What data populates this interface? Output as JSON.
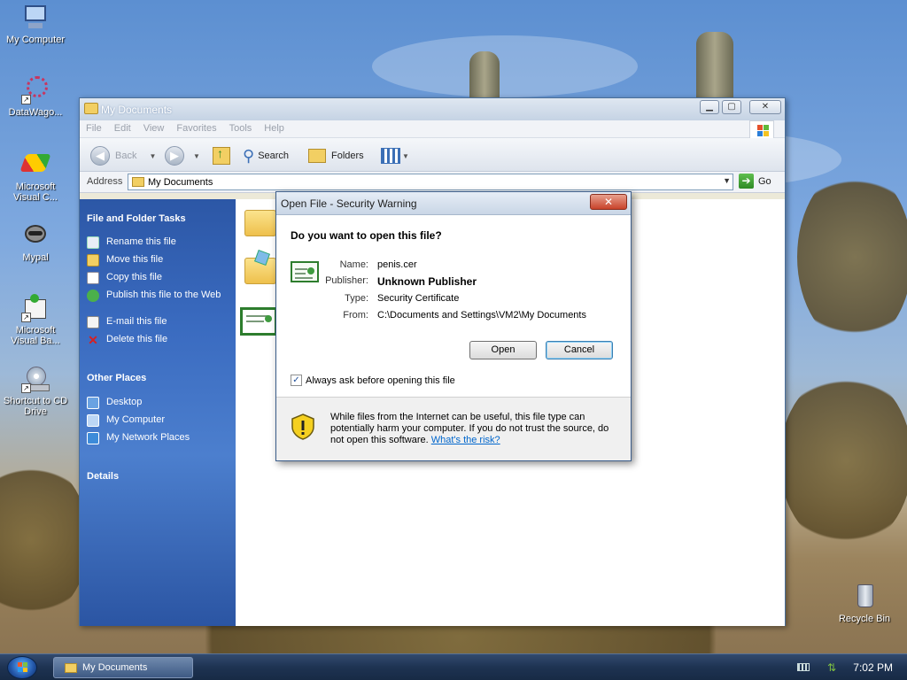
{
  "desktop": {
    "icons": [
      {
        "label": "My Computer"
      },
      {
        "label": "DataWago..."
      },
      {
        "label": "Microsoft Visual C..."
      },
      {
        "label": "Mypal"
      },
      {
        "label": "Microsoft Visual Ba..."
      },
      {
        "label": "Shortcut to CD Drive"
      },
      {
        "label": "Recycle Bin"
      }
    ]
  },
  "explorer": {
    "title": "My Documents",
    "menu": [
      "File",
      "Edit",
      "View",
      "Favorites",
      "Tools",
      "Help"
    ],
    "toolbar": {
      "back": "Back",
      "search": "Search",
      "folders": "Folders"
    },
    "address": {
      "label": "Address",
      "value": "My Documents",
      "go": "Go"
    },
    "sidebar": {
      "file_tasks_heading": "File and Folder Tasks",
      "file_tasks": [
        "Rename this file",
        "Move this file",
        "Copy this file",
        "Publish this file to the Web",
        "E-mail this file",
        "Delete this file"
      ],
      "other_places_heading": "Other Places",
      "other_places": [
        "Desktop",
        "My Computer",
        "My Network Places"
      ],
      "details_heading": "Details"
    }
  },
  "dialog": {
    "title": "Open File - Security Warning",
    "question": "Do you want to open this file?",
    "fields": [
      {
        "key": "Name:",
        "value": "penis.cer"
      },
      {
        "key": "Publisher:",
        "value": "Unknown Publisher"
      },
      {
        "key": "Type:",
        "value": "Security Certificate"
      },
      {
        "key": "From:",
        "value": "C:\\Documents and Settings\\VM2\\My Documents"
      }
    ],
    "open_button": "Open",
    "cancel_button": "Cancel",
    "checkbox_label": "Always ask before opening this file",
    "checkbox_checked": true,
    "warning_text": "While files from the Internet can be useful, this file type can potentially harm your computer. If you do not trust the source, do not open this software.",
    "risk_link": "What's the risk?"
  },
  "taskbar": {
    "task_label": "My Documents",
    "clock": "7:02 PM"
  }
}
